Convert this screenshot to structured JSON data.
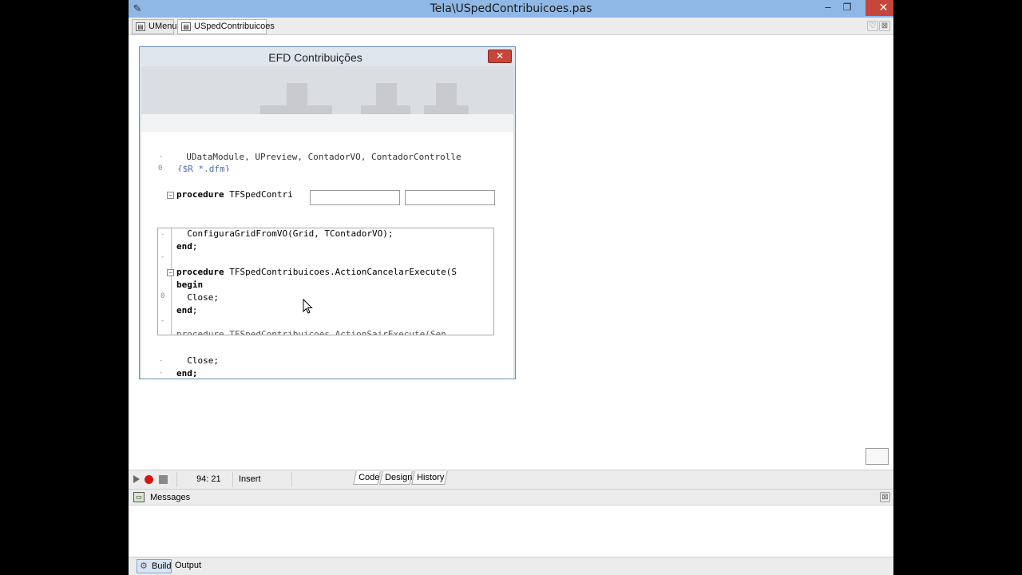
{
  "window": {
    "title": "Tela\\USpedContribuicoes.pas",
    "minimize_glyph": "–",
    "maximize_glyph": "❐",
    "close_glyph": "✕",
    "app_icon": "notepad-pencil-icon"
  },
  "tabs": [
    {
      "label": "UMenu",
      "icon": "unit-icon"
    },
    {
      "label": "USpedContribuicoes",
      "icon": "unit-icon",
      "active": true
    }
  ],
  "tab_controls": {
    "pin_glyph": "♡",
    "close_glyph": "⊠"
  },
  "form": {
    "caption": "EFD Contribuições",
    "close_glyph": "✕"
  },
  "code_behind": {
    "uses_line": "  UDataModule, UPreview, ContadorVO, ContadorControlle",
    "directive_line": "{$R *.dfm}",
    "procedure_kw": "procedure",
    "procedure_header": " TFSpedContri",
    "bottom_line1": "  Close;",
    "bottom_end": "end;",
    "gutter_marks": [
      "-",
      "0",
      "-",
      "-"
    ]
  },
  "inner_editor": {
    "lines": [
      {
        "text": "  ConfiguraGridFromVO(Grid, TContadorVO);",
        "bold": false
      },
      {
        "kw": "end",
        "rest": ";"
      },
      {
        "text": "",
        "bold": false
      },
      {
        "kw": "procedure",
        "rest": " TFSpedContribuicoes.ActionCancelarExecute(S"
      },
      {
        "kw": "begin",
        "rest": ""
      },
      {
        "text": "  Close;",
        "bold": false
      },
      {
        "kw": "end",
        "rest": ";"
      },
      {
        "text": "",
        "bold": false
      },
      {
        "text": "procedure TFSpedContribuicoes.ActionSairExecute(Sen",
        "bold": false
      }
    ],
    "gutter_marks": [
      "-",
      "-",
      "-",
      "-",
      "-",
      "0",
      "-",
      "-",
      "-"
    ]
  },
  "status": {
    "position": "94: 21",
    "mode": "Insert",
    "view_tabs": [
      "Code",
      "Design",
      "History"
    ],
    "active_view": "Code"
  },
  "messages": {
    "title": "Messages",
    "close_glyph": "⊠"
  },
  "bottom_tabs": [
    "Build",
    "Output"
  ]
}
